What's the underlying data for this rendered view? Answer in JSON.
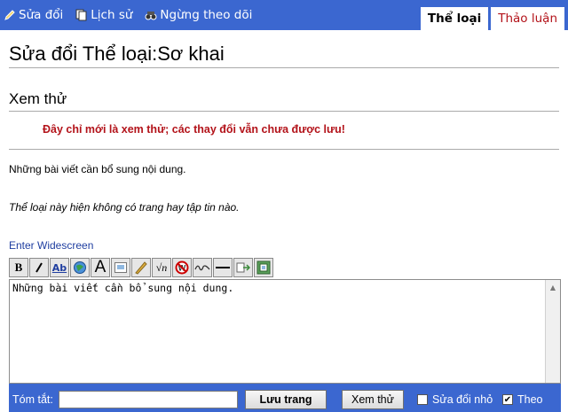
{
  "topbar": {
    "actions": [
      {
        "label": "Sửa đổi",
        "icon": "pencil-icon"
      },
      {
        "label": "Lịch sử",
        "icon": "pages-icon"
      },
      {
        "label": "Ngừng theo dõi",
        "icon": "binoculars-icon"
      }
    ],
    "tabs": [
      {
        "label": "Thể loại",
        "active": true
      },
      {
        "label": "Thảo luận",
        "active": false
      }
    ]
  },
  "page": {
    "title": "Sửa đổi Thể loại:Sơ khai",
    "preview_heading": "Xem thử",
    "preview_note": "Đây chỉ mới là xem thử; các thay đổi vẫn chưa được lưu!",
    "body_text": "Những bài viết cần bổ sung nội dung.",
    "empty_text": "Thể loại này hiện không có trang hay tập tin nào.",
    "widescreen_link": "Enter Widescreen"
  },
  "toolbar": {
    "buttons": [
      {
        "name": "bold-icon",
        "glyph": "B"
      },
      {
        "name": "italic-icon",
        "glyph": "/"
      },
      {
        "name": "internal-link-icon",
        "glyph": "Ab"
      },
      {
        "name": "external-link-icon",
        "glyph": "🌐"
      },
      {
        "name": "heading-icon",
        "glyph": "A"
      },
      {
        "name": "image-icon",
        "glyph": "▣"
      },
      {
        "name": "media-icon",
        "glyph": "✎"
      },
      {
        "name": "math-icon",
        "glyph": "√n"
      },
      {
        "name": "nowiki-icon",
        "glyph": "W"
      },
      {
        "name": "signature-icon",
        "glyph": "~"
      },
      {
        "name": "horizontal-line-icon",
        "glyph": "—"
      },
      {
        "name": "redirect-icon",
        "glyph": "⇄"
      },
      {
        "name": "gallery-icon",
        "glyph": "▦"
      }
    ]
  },
  "editor": {
    "content": "Những bài viết cần bổ sung nội dung."
  },
  "bottombar": {
    "summary_label": "Tóm tắt:",
    "summary_value": "",
    "save_label": "Lưu trang",
    "preview_label": "Xem thử",
    "minor_label": "Sửa đổi nhỏ",
    "minor_checked": false,
    "watch_label": "Theo",
    "watch_checked": true
  },
  "colors": {
    "bar": "#3b67d0",
    "note_red": "#b3131a",
    "link_blue": "#1f3ea0"
  }
}
